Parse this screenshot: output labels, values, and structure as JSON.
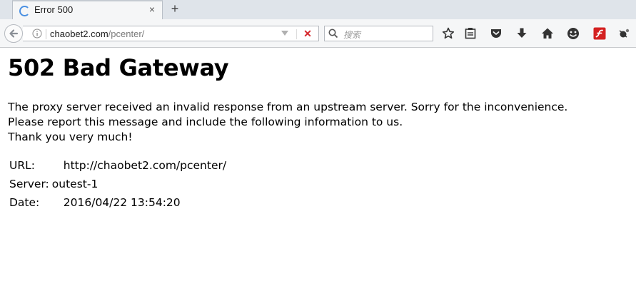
{
  "browser": {
    "tab": {
      "title": "Error 500",
      "close": "×"
    },
    "new_tab": "+",
    "url": {
      "host": "chaobet2.com",
      "path": "/pcenter/"
    },
    "stop": "✕",
    "search": {
      "placeholder": "搜索"
    }
  },
  "page": {
    "heading": "502 Bad Gateway",
    "lines": [
      "The proxy server received an invalid response from an upstream server. Sorry for the inconvenience.",
      "Please report this message and include the following information to us.",
      "Thank you very much!"
    ],
    "details": [
      {
        "label": "URL:",
        "value": "http://chaobet2.com/pcenter/"
      },
      {
        "label": "Server:",
        "value": "outest-1"
      },
      {
        "label": "Date:",
        "value": "2016/04/22 13:54:20"
      }
    ]
  },
  "toolbar_icons": [
    "star-icon",
    "reading-list-icon",
    "pocket-icon",
    "downloads-icon",
    "home-icon",
    "smiley-icon",
    "flash-icon",
    "extension-icon"
  ]
}
